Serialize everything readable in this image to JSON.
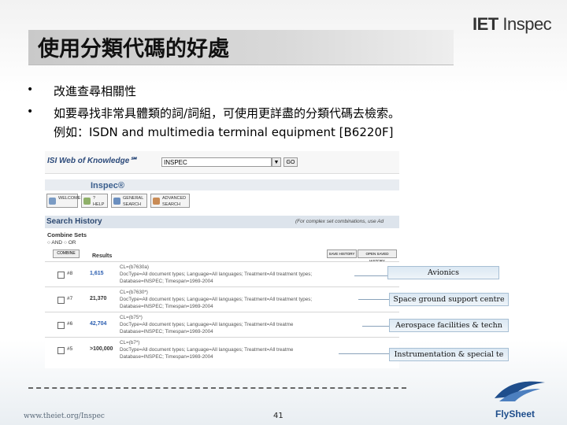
{
  "slide": {
    "title": "使用分類代碼的好處",
    "brand": {
      "iet": "IET",
      "inspec": "Inspec"
    },
    "bullets": [
      {
        "symbol": "•",
        "lines": [
          "改進查尋相關性"
        ]
      },
      {
        "symbol": "•",
        "lines": [
          "如要尋找非常具體類的詞/詞組，可使用更詳盡的分類代碼去檢索。",
          "例如：ISDN and multimedia terminal equipment [B6220F]"
        ]
      }
    ],
    "footer": {
      "url": "www.theiet.org/Inspec",
      "page": "41",
      "flysheet": "FlySheet"
    }
  },
  "screenshot": {
    "wok_title": "ISI Web of Knowledge℠",
    "database_select": "INSPEC",
    "go_label": "GO",
    "inspec_label": "Inspec®",
    "nav": [
      {
        "label": "WELCOME",
        "icon": "home-icon",
        "color": "#7a9bc4"
      },
      {
        "label": "? HELP",
        "icon": "help-icon",
        "color": "#8fb06a"
      },
      {
        "label": "GENERAL SEARCH",
        "icon": "search-icon",
        "color": "#6b8fbf"
      },
      {
        "label": "ADVANCED SEARCH",
        "icon": "advanced-search-icon",
        "color": "#c98b55"
      }
    ],
    "search_history_title": "Search History",
    "complex_note": "(For complex set combinations, use Ad",
    "combine_sets": "Combine Sets",
    "radio_and": "AND",
    "radio_or": "OR",
    "combine_button": "COMBINE",
    "results_header": "Results",
    "save_history": "SAVE HISTORY",
    "open_saved": "OPEN SAVED HISTORY",
    "rows": [
      {
        "set": "#8",
        "results": "1,615",
        "query": [
          "CL=(b7630a)",
          "DocType=All document types; Language=All languages; Treatment=All treatment types;",
          "Database=INSPEC; Timespan=1969-2004"
        ],
        "results_color": "#2a5db0"
      },
      {
        "set": "#7",
        "results": "21,370",
        "query": [
          "CL=(b7630*)",
          "DocType=All document types; Language=All languages; Treatment=All treatment types;",
          "Database=INSPEC; Timespan=1969-2004"
        ],
        "results_color": "#333333"
      },
      {
        "set": "#6",
        "results": "42,704",
        "query": [
          "CL=(b75*)",
          "DocType=All document types; Language=All languages; Treatment=All treatme",
          "Database=INSPEC; Timespan=1969-2004"
        ],
        "results_color": "#2a5db0"
      },
      {
        "set": "#5",
        "results": ">100,000",
        "query": [
          "CL=(b7*)",
          "DocType=All document types; Language=All languages; Treatment=All treatme",
          "Database=INSPEC; Timespan=1969-2004"
        ],
        "results_color": "#333333"
      }
    ]
  },
  "callouts": [
    "Avionics",
    "Space ground support centre",
    "Aerospace facilities & techn",
    "Instrumentation & special te"
  ]
}
